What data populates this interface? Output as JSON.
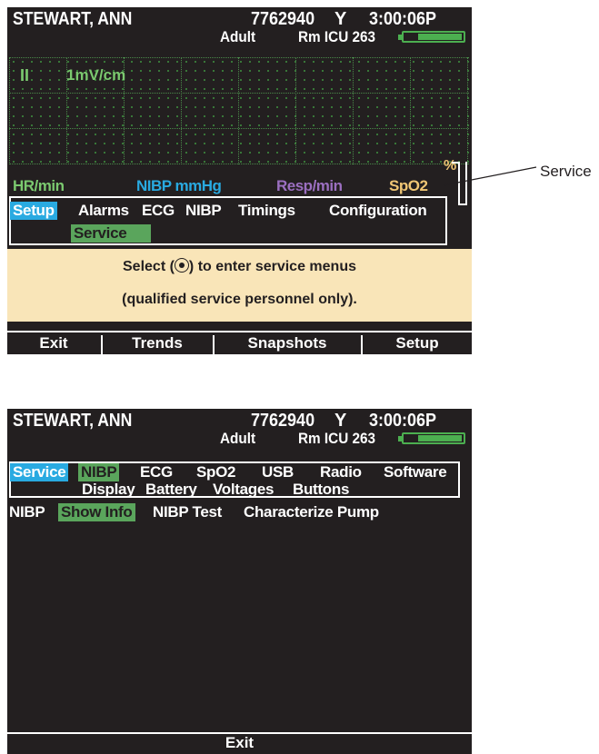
{
  "screen1": {
    "header": {
      "patient_name": "STEWART, ANN",
      "patient_id": "7762940",
      "antenna_glyph": "Y",
      "time": "3:00:06P",
      "patient_type": "Adult",
      "room": "Rm ICU 263",
      "battery_icon": "battery-icon"
    },
    "waveform": {
      "lead": "II",
      "gain": "1mV/cm",
      "grid_color": "#4a8a4a"
    },
    "params": [
      {
        "label": "HR/min",
        "color": "#7bc96f"
      },
      {
        "label": "NIBP mmHg",
        "color": "#29aae1"
      },
      {
        "label": "Resp/min",
        "color": "#9b6fc0"
      },
      {
        "label": "SpO2",
        "color": "#f0c674"
      }
    ],
    "percent_label": "%",
    "menu": {
      "items": [
        "Setup",
        "Alarms",
        "ECG",
        "NIBP",
        "Timings",
        "Configuration"
      ],
      "submenu": [
        "Service"
      ]
    },
    "message": {
      "line1_pre": "Select (",
      "line1_post": ") to enter service menus",
      "line2": "(qualified service personnel only)."
    },
    "softkeys": [
      "Exit",
      "Trends",
      "Snapshots",
      "Setup"
    ]
  },
  "callout": {
    "label": "Service"
  },
  "screen2": {
    "header": {
      "patient_name": "STEWART, ANN",
      "patient_id": "7762940",
      "antenna_glyph": "Y",
      "time": "3:00:06P",
      "patient_type": "Adult",
      "room": "Rm ICU 263"
    },
    "menu_row1": [
      "Service",
      "NIBP",
      "ECG",
      "SpO2",
      "USB",
      "Radio",
      "Software"
    ],
    "menu_row2": [
      "Display",
      "Battery",
      "Voltages",
      "Buttons"
    ],
    "nibp_row": [
      "NIBP",
      "Show Info",
      "NIBP Test",
      "Characterize Pump"
    ],
    "softkey": "Exit"
  },
  "colors": {
    "screen_bg": "#231f20",
    "accent_blue": "#29aae1",
    "accent_green": "#5aa55c",
    "message_bg": "#f9e5b8"
  }
}
